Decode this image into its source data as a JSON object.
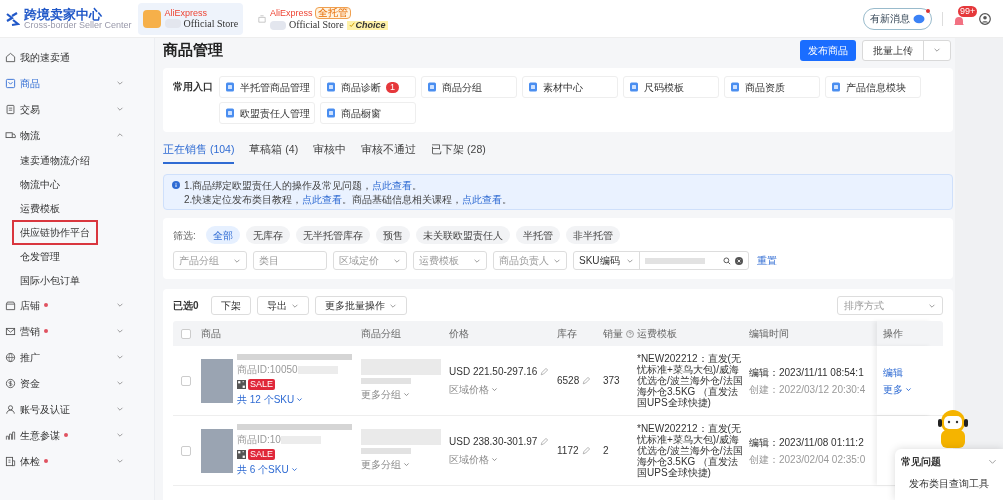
{
  "header": {
    "logo_title": "跨境卖家中心",
    "logo_subtitle": "Cross-border Seller Center",
    "stores": [
      {
        "brand": "AliExpress",
        "name": "Official Store",
        "selected": true
      },
      {
        "brand": "AliExpress",
        "name": "Official Store",
        "badge": "全托管",
        "tag": "Choice",
        "selected": false
      }
    ],
    "message_button": "有新消息",
    "notification_count": "99+"
  },
  "sidebar": {
    "items": [
      {
        "label": "我的速卖通",
        "dot": false,
        "expandable": false,
        "selected": false
      },
      {
        "label": "商品",
        "dot": false,
        "expandable": true,
        "expanded": false,
        "selected": true
      },
      {
        "label": "交易",
        "dot": false,
        "expandable": true,
        "expanded": false,
        "selected": false
      },
      {
        "label": "物流",
        "dot": false,
        "expandable": true,
        "expanded": true,
        "selected": false,
        "children": [
          {
            "label": "速卖通物流介绍",
            "highlighted": false
          },
          {
            "label": "物流中心",
            "highlighted": false
          },
          {
            "label": "运费模板",
            "highlighted": false
          },
          {
            "label": "供应链协作平台",
            "highlighted": true
          },
          {
            "label": "仓发管理",
            "highlighted": false
          },
          {
            "label": "国际小包订单",
            "highlighted": false
          }
        ]
      },
      {
        "label": "店铺",
        "dot": true,
        "expandable": true,
        "expanded": false,
        "selected": false
      },
      {
        "label": "营销",
        "dot": true,
        "expandable": true,
        "expanded": false,
        "selected": false
      },
      {
        "label": "推广",
        "dot": false,
        "expandable": true,
        "expanded": false,
        "selected": false
      },
      {
        "label": "资金",
        "dot": false,
        "expandable": true,
        "expanded": false,
        "selected": false
      },
      {
        "label": "账号及认证",
        "dot": false,
        "expandable": true,
        "expanded": false,
        "selected": false
      },
      {
        "label": "生意参谋",
        "dot": true,
        "expandable": true,
        "expanded": false,
        "selected": false
      },
      {
        "label": "体检",
        "dot": true,
        "expandable": true,
        "expanded": false,
        "selected": false
      }
    ]
  },
  "page_title": "商品管理",
  "actions": {
    "primary": "发布商品",
    "secondary": "批量上传"
  },
  "quick_entries": {
    "label": "常用入口",
    "items": [
      {
        "label": "半托管商品管理"
      },
      {
        "label": "商品诊断",
        "badge": "1"
      },
      {
        "label": "商品分组"
      },
      {
        "label": "素材中心"
      },
      {
        "label": "尺码模板"
      },
      {
        "label": "商品资质"
      },
      {
        "label": "产品信息模块"
      },
      {
        "label": "欧盟责任人管理"
      },
      {
        "label": "商品橱窗"
      }
    ]
  },
  "tabs": [
    {
      "label": "正在销售 (104)",
      "selected": true
    },
    {
      "label": "草稿箱 (4)",
      "selected": false
    },
    {
      "label": "审核中",
      "selected": false
    },
    {
      "label": "审核不通过",
      "selected": false
    },
    {
      "label": "已下架 (28)",
      "selected": false
    }
  ],
  "notice": {
    "lines": [
      [
        {
          "kind": "text",
          "text": "1.商品绑定欧盟责任人的操作及常见问题，"
        },
        {
          "kind": "link",
          "text": "点此查看"
        },
        {
          "kind": "text",
          "text": "。"
        }
      ],
      [
        {
          "kind": "text",
          "text": "2.快速定位发布类目教程，"
        },
        {
          "kind": "link",
          "text": "点此查看"
        },
        {
          "kind": "text",
          "text": "。商品基础信息相关课程，"
        },
        {
          "kind": "link",
          "text": "点此查看"
        },
        {
          "kind": "text",
          "text": "。"
        }
      ]
    ]
  },
  "filters": {
    "label": "筛选:",
    "chips": [
      {
        "label": "全部",
        "selected": true
      },
      {
        "label": "无库存",
        "selected": false
      },
      {
        "label": "无半托管库存",
        "selected": false
      },
      {
        "label": "预售",
        "selected": false
      },
      {
        "label": "未关联欧盟责任人",
        "selected": false
      },
      {
        "label": "半托管",
        "selected": false
      },
      {
        "label": "非半托管",
        "selected": false
      }
    ],
    "fields": [
      {
        "kind": "select",
        "placeholder": "产品分组"
      },
      {
        "kind": "input",
        "placeholder": "类目"
      },
      {
        "kind": "select",
        "placeholder": "区域定价"
      },
      {
        "kind": "select",
        "placeholder": "运费模板"
      },
      {
        "kind": "select",
        "placeholder": "商品负责人"
      }
    ],
    "sku_select": "SKU编码",
    "reset": "重置"
  },
  "toolbar": {
    "selected_count": "已选0",
    "buttons": [
      {
        "label": "下架",
        "dropdown": false
      },
      {
        "label": "导出",
        "dropdown": true
      },
      {
        "label": "更多批量操作",
        "dropdown": true
      }
    ],
    "sort_placeholder": "排序方式"
  },
  "table": {
    "header_checked": false,
    "columns": [
      "商品",
      "商品分组",
      "价格",
      "库存",
      "销量",
      "运费模板",
      "编辑时间",
      "操作"
    ],
    "rows": [
      {
        "checked": false,
        "product_id": "商品ID:10050",
        "sale_tag": "SALE",
        "sku_count": "共 12 个SKU",
        "more_groups": "更多分组",
        "price": "USD 221.50-297.16",
        "regional_price": "区域价格",
        "stock": "6528",
        "sales": "373",
        "shipping": "*NEW202212：直发(无忧标准+菜鸟大包)/威海优选仓/波兰海外仓/法国海外仓3.5KG （直发法国UPS全球快捷)",
        "edited": "编辑：2023/11/11 08:54:1",
        "created": "创建：2022/03/12 20:30:4",
        "actions": [
          "编辑",
          "更多"
        ]
      },
      {
        "checked": false,
        "product_id": "商品ID:10",
        "sale_tag": "SALE",
        "sku_count": "共 6 个SKU",
        "more_groups": "更多分组",
        "price": "USD 238.30-301.97",
        "regional_price": "区域价格",
        "stock": "1172",
        "sales": "2",
        "shipping": "*NEW202212：直发(无忧标准+菜鸟大包)/威海优选仓/波兰海外仓/法国海外仓3.5KG （直发法国UPS全球快捷)",
        "edited": "编辑：2023/11/08 01:11:2",
        "created": "创建：2023/02/04 02:35:0"
      }
    ]
  },
  "help_panel": {
    "title": "常见问题",
    "items": [
      "发布类目查询工具"
    ]
  }
}
